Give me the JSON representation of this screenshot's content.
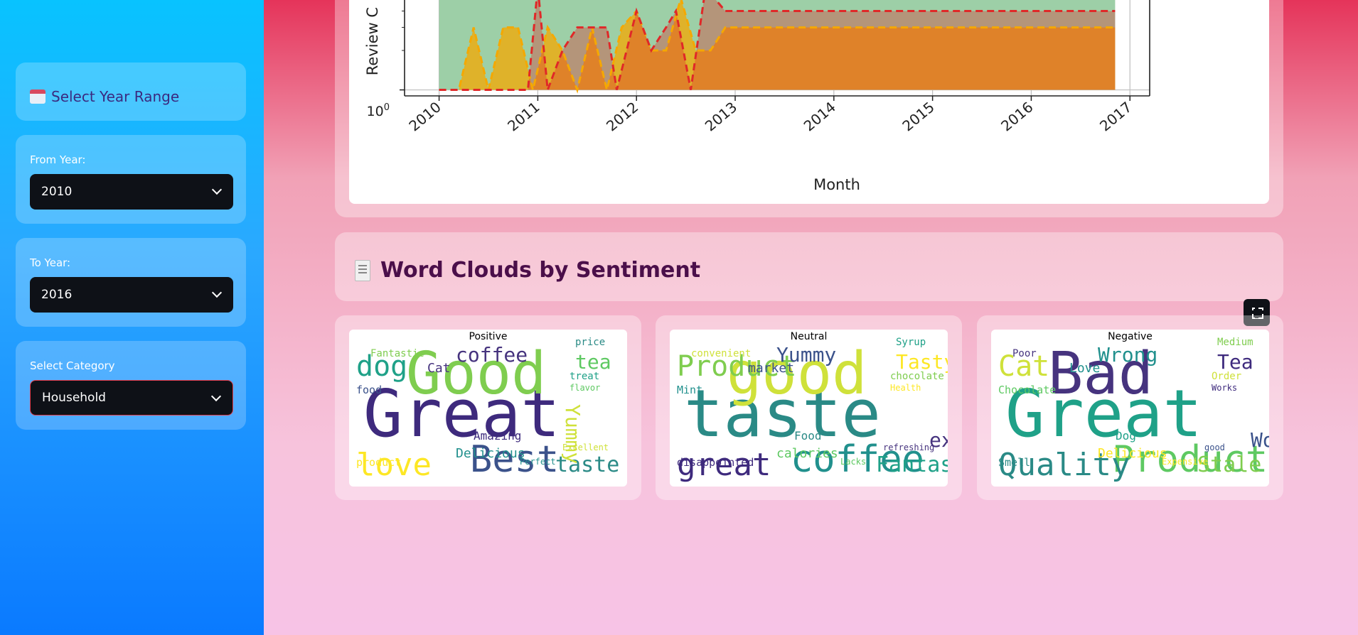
{
  "sidebar": {
    "range_title": "Select Year Range",
    "from_label": "From Year:",
    "from_value": "2010",
    "to_label": "To Year:",
    "to_value": "2016",
    "category_label": "Select Category",
    "category_value": "Household"
  },
  "chart_data": {
    "type": "area",
    "xlabel": "Month",
    "ylabel": "Review C",
    "y_tick_label": "10",
    "y_tick_exp": "0",
    "x_ticks": [
      "2010",
      "2011",
      "2012",
      "2013",
      "2014",
      "2015",
      "2016",
      "2017"
    ],
    "y_scale": "log",
    "grid": true,
    "series": [
      {
        "color": "#f5a800",
        "style": "dashed",
        "x": [
          2010.0,
          2010.2,
          2010.35,
          2010.5,
          2010.65,
          2010.8,
          2010.95,
          2011.1,
          2011.25,
          2011.4,
          2011.55,
          2011.7,
          2011.85,
          2012.0,
          2012.15,
          2012.3,
          2012.45,
          2012.6,
          2012.75,
          2012.9,
          2013.0,
          2014.0,
          2015.0,
          2016.0,
          2016.85
        ],
        "values": [
          1,
          1,
          3,
          1,
          3,
          3,
          1,
          3,
          2,
          1,
          3,
          1,
          3,
          4,
          2,
          2,
          5,
          2,
          2,
          3,
          3,
          3,
          3,
          3,
          3
        ]
      },
      {
        "color": "#e02828",
        "style": "dashed",
        "x": [
          2010.0,
          2010.6,
          2010.9,
          2011.0,
          2011.1,
          2011.25,
          2011.4,
          2011.55,
          2011.7,
          2011.8,
          2012.0,
          2012.15,
          2012.3,
          2012.4,
          2012.55,
          2012.7,
          2012.9,
          2013.0,
          2014.0,
          2015.0,
          2016.0,
          2016.85
        ],
        "values": [
          1,
          1,
          1,
          8,
          1,
          2,
          3,
          3,
          3,
          1,
          4,
          2,
          3,
          4,
          1,
          6,
          4,
          4,
          4,
          4,
          4,
          4
        ]
      }
    ]
  },
  "wordclouds": {
    "section_title": "Word Clouds by Sentiment",
    "panels": [
      {
        "label": "Positive",
        "words": [
          "Great",
          "Good",
          "Best",
          "love",
          "dog",
          "coffee",
          "tea",
          "taste",
          "Yummy",
          "Delicious",
          "Amazing",
          "Fantastic",
          "food",
          "product",
          "treat",
          "Cat",
          "flavor",
          "price",
          "Excellent",
          "Perfect"
        ]
      },
      {
        "label": "Neutral",
        "words": [
          "taste",
          "good",
          "coffee",
          "great",
          "Product",
          "Yummy",
          "Tasty",
          "Fantastic",
          "expensive",
          "calories",
          "Food",
          "convenient",
          "Mint",
          "disappointed",
          "chocolate",
          "market",
          "Health",
          "Syrup",
          "refreshing",
          "Lacks"
        ]
      },
      {
        "label": "Negative",
        "words": [
          "Great",
          "Bad",
          "Product",
          "Quality",
          "Cat",
          "Wrong",
          "Tea",
          "Stale",
          "Worst",
          "Delicious",
          "Dog",
          "Poor",
          "Chocolate",
          "Smell",
          "Order",
          "Love",
          "Works",
          "Medium",
          "good",
          "Expensive"
        ]
      }
    ]
  }
}
